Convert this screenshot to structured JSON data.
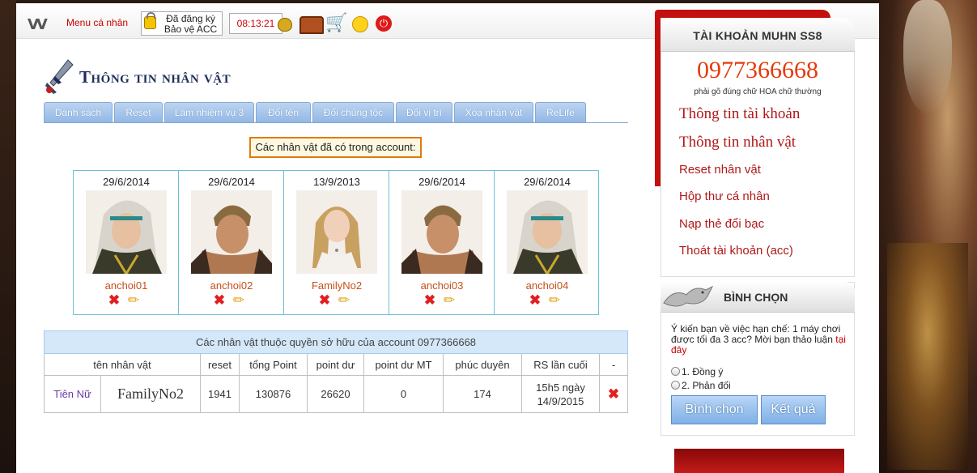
{
  "topbar": {
    "menu_label": "Menu cá nhân",
    "registered_line1": "Đã đăng ký",
    "registered_line2": "Bảo vệ ACC",
    "clock": "08:13:21"
  },
  "page_title": "Thông tin nhân vật",
  "tabs": [
    "Danh sách",
    "Reset",
    "Làm nhiệm vụ 3",
    "Đổi tên",
    "Đổi chủng tộc",
    "Đổi vị trí",
    "Xóa nhân vật",
    "ReLife"
  ],
  "notice": "Các nhân vật đã có trong account:",
  "characters": [
    {
      "date": "29/6/2014",
      "name": "anchoi01",
      "portrait": "white-hair-elf-icon"
    },
    {
      "date": "29/6/2014",
      "name": "anchoi02",
      "portrait": "brown-hair-warrior-icon"
    },
    {
      "date": "13/9/2013",
      "name": "FamilyNo2",
      "portrait": "blonde-female-icon"
    },
    {
      "date": "29/6/2014",
      "name": "anchoi03",
      "portrait": "brown-hair-warrior-icon"
    },
    {
      "date": "29/6/2014",
      "name": "anchoi04",
      "portrait": "white-hair-elf-icon"
    }
  ],
  "ownership": {
    "caption": "Các nhân vật thuộc quyền sở hữu của account 0977366668",
    "headers": [
      "tên nhân vật",
      "reset",
      "tổng Point",
      "point dư",
      "point dư MT",
      "phúc duyên",
      "RS lần cuối",
      "-"
    ],
    "row": {
      "class": "Tiên Nữ",
      "name": "FamilyNo2",
      "reset": "1941",
      "total_point": "130876",
      "point_left": "26620",
      "point_left_mt": "0",
      "phuc_duyen": "174",
      "rs_last_line1": "15h5 ngày",
      "rs_last_line2": "14/9/2015"
    }
  },
  "sidebar": {
    "header": "TÀI KHOẢN MUHN SS8",
    "phone": "0977366668",
    "phone_note": "phải gõ đúng chữ HOA chữ thường",
    "links": [
      "Thông tin tài khoản",
      "Thông tin nhân vật",
      "Reset nhân vật",
      "Hộp thư cá nhân",
      "Nạp thẻ đổi bạc",
      "Thoát tài khoản (acc)"
    ]
  },
  "vote": {
    "title": "BÌNH CHỌN",
    "question": "Ý kiến bạn về việc hạn chế: 1 máy chơi được tối đa 3 acc? Mời bạn thảo luận",
    "question_link": "tại đây",
    "options": [
      "1. Đồng ý",
      "2. Phản đối"
    ],
    "vote_button": "Bình chọn",
    "result_button": "Kết quả"
  },
  "colors": {
    "accent_red": "#c40f0f",
    "tab_blue": "#93b8e6",
    "name_orange": "#c4501a",
    "phone_red": "#e63a0a"
  }
}
